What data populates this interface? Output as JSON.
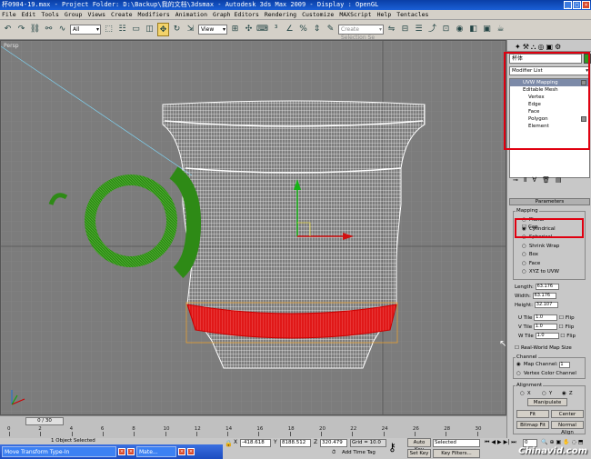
{
  "title_bar": {
    "text": "杯0904-19.max    - Project Folder: D:\\Backup\\我的文档\\3dsmax    - Autodesk 3ds Max  2009      - Display : OpenGL"
  },
  "menu": [
    "File",
    "Edit",
    "Tools",
    "Group",
    "Views",
    "Create",
    "Modifiers",
    "Animation",
    "Graph Editors",
    "Rendering",
    "Customize",
    "MAXScript",
    "Help",
    "Tentacles"
  ],
  "toolbar": {
    "filter_value": "All",
    "ref_coord_value": "View",
    "selection_set_placeholder": "Create Selection Se"
  },
  "viewport": {
    "label": "Persp"
  },
  "command_panel": {
    "object_name": "杯体",
    "object_color": "#2f9a1f",
    "modifier_list_label": "Modifier List",
    "stack": [
      {
        "label": "UVW Mapping",
        "highlighted": true
      },
      {
        "label": "Editable Mesh"
      },
      {
        "label": "Vertex",
        "sub": true
      },
      {
        "label": "Edge",
        "sub": true
      },
      {
        "label": "Face",
        "sub": true
      },
      {
        "label": "Polygon",
        "sub": true
      },
      {
        "label": "Element",
        "sub": true
      }
    ],
    "parameters_title": "Parameters",
    "mapping_group": "Mapping",
    "mapping_options": [
      "Planar",
      "Cylindrical",
      "Spherical",
      "Shrink Wrap",
      "Box",
      "Face",
      "XYZ to UVW"
    ],
    "mapping_selected": "Cylindrical",
    "cap_label": "Cap",
    "length_label": "Length:",
    "length_value": "63.176",
    "width_label": "Width:",
    "width_value": "63.176",
    "height_label": "Height:",
    "height_value": "32.107",
    "utile_label": "U Tile",
    "utile_value": "1.0",
    "vtile_label": "V Tile",
    "vtile_value": "1.0",
    "wtile_label": "W Tile",
    "wtile_value": "1.0",
    "flip_label": "Flip",
    "real_world_label": "Real-World Map Size",
    "channel_group": "Channel",
    "map_channel_label": "Map Channel:",
    "map_channel_value": "1",
    "vertex_color_label": "Vertex Color Channel",
    "alignment_group": "Alignment",
    "axis_x": "X",
    "axis_y": "Y",
    "axis_z": "Z",
    "manipulate_label": "Manipulate",
    "fit_label": "Fit",
    "center_label": "Center",
    "bitmap_fit_label": "Bitmap Fit",
    "normal_align_label": "Normal Align"
  },
  "timeline": {
    "slider_text": "0 / 30",
    "ticks": [
      "0",
      "2",
      "4",
      "6",
      "8",
      "10",
      "12",
      "14",
      "16",
      "18",
      "20",
      "22",
      "24",
      "26",
      "28",
      "30"
    ]
  },
  "status": {
    "selected_text": "1 Object Selected",
    "x_label": "X",
    "x_value": "-418.618",
    "y_label": "Y",
    "y_value": "8188.512",
    "z_label": "Z",
    "z_value": "320.479",
    "grid": "Grid = 10.0",
    "auto_key": "Auto Key",
    "set_key": "Set Key",
    "key_mode_value": "Selected",
    "key_filters": "Key Filters...",
    "add_time_tag": "Add Time Tag",
    "frame_value": "0"
  },
  "taskbar": {
    "items": [
      "Move Transform Type-In",
      "Mate..."
    ]
  },
  "watermark": "Chinavid.com"
}
